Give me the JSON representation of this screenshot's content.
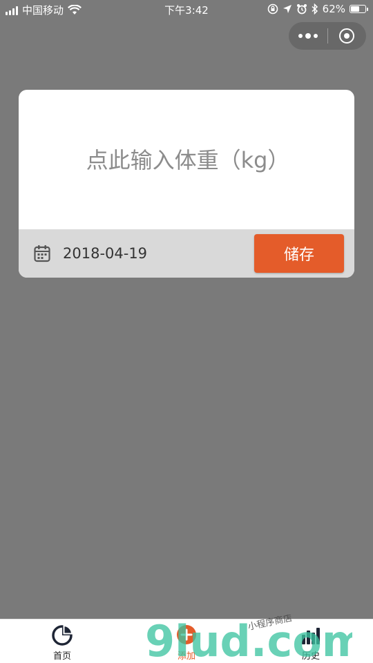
{
  "status_bar": {
    "carrier": "中国移动",
    "time": "下午3:42",
    "battery_percent": "62%",
    "battery_level": 0.62,
    "icons": [
      "signal-icon",
      "wifi-icon",
      "orientation-lock-icon",
      "location-icon",
      "alarm-icon",
      "bluetooth-icon",
      "battery-icon"
    ]
  },
  "capsule": {
    "icons": [
      "more-icon",
      "close-miniprogram-icon"
    ]
  },
  "weight_card": {
    "placeholder": "点此输入体重（kg）",
    "value": "",
    "date": "2018-04-19",
    "save_label": "储存",
    "icons": [
      "calendar-icon"
    ]
  },
  "tabbar": {
    "tabs": [
      {
        "label": "首页",
        "icon": "pie-chart-icon",
        "active": false
      },
      {
        "label": "添加",
        "icon": "add-icon",
        "active": true
      },
      {
        "label": "历史",
        "icon": "bar-chart-icon",
        "active": false
      }
    ]
  },
  "watermark": {
    "text": "9lud.com",
    "subtext": "小程序商店"
  },
  "colors": {
    "accent": "#e45c2a",
    "overlay": "#7a7a7a",
    "card_footer": "#d9d9d9"
  }
}
